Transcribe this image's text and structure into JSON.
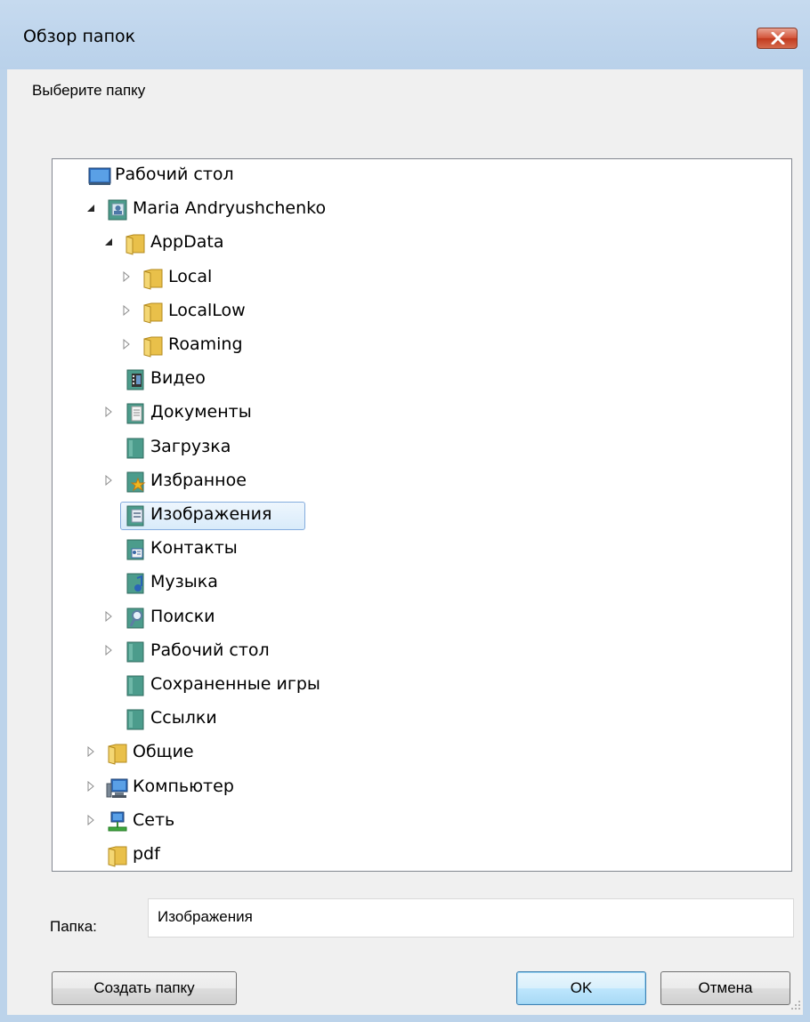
{
  "window": {
    "title": "Обзор папок",
    "prompt": "Выберите папку"
  },
  "tree": {
    "items": [
      {
        "label": "Рабочий стол",
        "icon": "desktop-icon",
        "level": 0,
        "expander": "none"
      },
      {
        "label": "Maria Andryushchenko",
        "icon": "user-folder-icon",
        "level": 1,
        "expander": "expanded"
      },
      {
        "label": "AppData",
        "icon": "folder-icon",
        "level": 2,
        "expander": "expanded"
      },
      {
        "label": "Local",
        "icon": "folder-icon",
        "level": 3,
        "expander": "collapsed"
      },
      {
        "label": "LocalLow",
        "icon": "folder-icon",
        "level": 3,
        "expander": "collapsed"
      },
      {
        "label": "Roaming",
        "icon": "folder-icon",
        "level": 3,
        "expander": "collapsed"
      },
      {
        "label": "Видео",
        "icon": "videos-icon",
        "level": 2,
        "expander": "none"
      },
      {
        "label": "Документы",
        "icon": "documents-icon",
        "level": 2,
        "expander": "collapsed"
      },
      {
        "label": "Загрузка",
        "icon": "downloads-icon",
        "level": 2,
        "expander": "none"
      },
      {
        "label": "Избранное",
        "icon": "favorites-icon",
        "level": 2,
        "expander": "collapsed"
      },
      {
        "label": "Изображения",
        "icon": "pictures-icon",
        "level": 2,
        "expander": "none",
        "selected": true
      },
      {
        "label": "Контакты",
        "icon": "contacts-icon",
        "level": 2,
        "expander": "none"
      },
      {
        "label": "Музыка",
        "icon": "music-icon",
        "level": 2,
        "expander": "none"
      },
      {
        "label": "Поиски",
        "icon": "searches-icon",
        "level": 2,
        "expander": "collapsed"
      },
      {
        "label": "Рабочий стол",
        "icon": "desktop-folder-icon",
        "level": 2,
        "expander": "collapsed"
      },
      {
        "label": "Сохраненные игры",
        "icon": "saved-games-icon",
        "level": 2,
        "expander": "none"
      },
      {
        "label": "Ссылки",
        "icon": "links-icon",
        "level": 2,
        "expander": "none"
      },
      {
        "label": "Общие",
        "icon": "folder-icon",
        "level": 1,
        "expander": "collapsed"
      },
      {
        "label": "Компьютер",
        "icon": "computer-icon",
        "level": 1,
        "expander": "collapsed"
      },
      {
        "label": "Сеть",
        "icon": "network-icon",
        "level": 1,
        "expander": "collapsed"
      },
      {
        "label": "pdf",
        "icon": "folder-icon",
        "level": 1,
        "expander": "none"
      }
    ]
  },
  "folder_field": {
    "label": "Папка:",
    "value": "Изображения"
  },
  "buttons": {
    "new_folder": "Создать папку",
    "ok": "OK",
    "cancel": "Отмена"
  },
  "colors": {
    "titlebar": "#b9d1ea",
    "close_button": "#c7432a",
    "selection_border": "#84acdd",
    "folder_yellow": "#e9c04a"
  }
}
